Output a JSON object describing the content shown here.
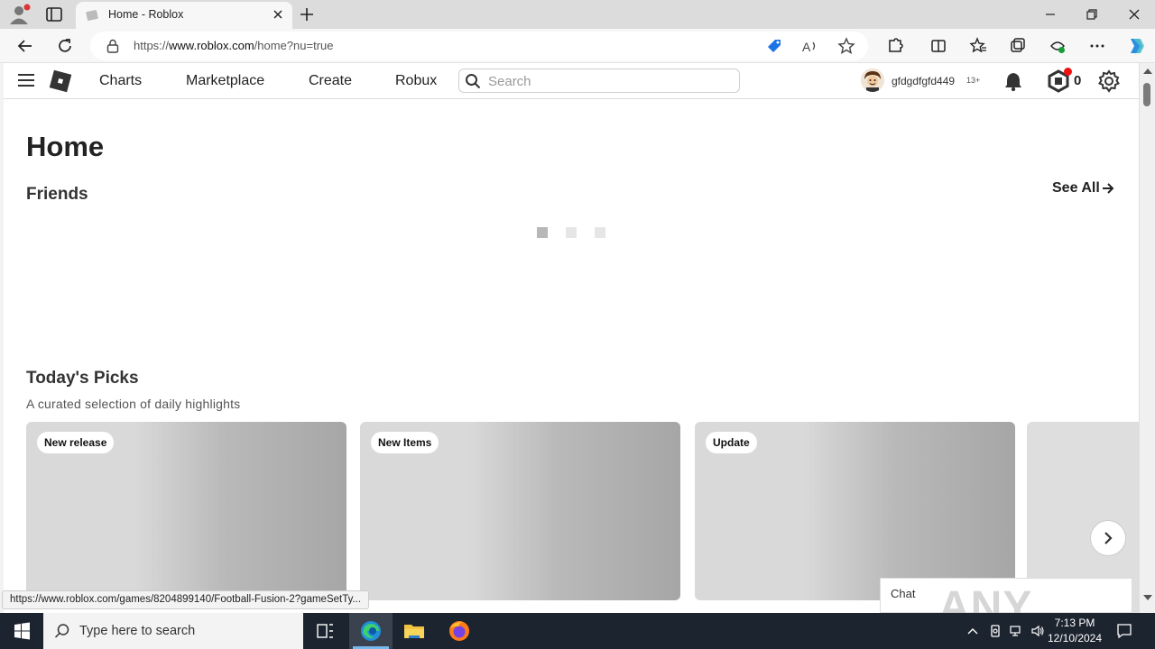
{
  "browser": {
    "tab_title": "Home - Roblox",
    "url_prefix": "https://",
    "url_domain": "www.roblox.com",
    "url_path": "/home?nu=true"
  },
  "header": {
    "nav": [
      "Charts",
      "Marketplace",
      "Create",
      "Robux"
    ],
    "search_placeholder": "Search",
    "username": "gfdgdfgfd449",
    "age_badge": "13+",
    "robux_count": "0"
  },
  "main": {
    "title": "Home",
    "friends_heading": "Friends",
    "see_all": "See All",
    "picks_heading": "Today's Picks",
    "picks_subtitle": "A curated selection of daily highlights",
    "cards": [
      {
        "badge": "New release"
      },
      {
        "badge": "New Items"
      },
      {
        "badge": "Update"
      }
    ],
    "chat_label": "Chat"
  },
  "status_url": "https://www.roblox.com/games/8204899140/Football-Fusion-2?gameSetTy...",
  "watermark": "ANY RUN",
  "taskbar": {
    "search_placeholder": "Type here to search",
    "time": "7:13 PM",
    "date": "12/10/2024"
  },
  "colors": {
    "accent": "#0078d4",
    "notification_red": "#e11111"
  }
}
